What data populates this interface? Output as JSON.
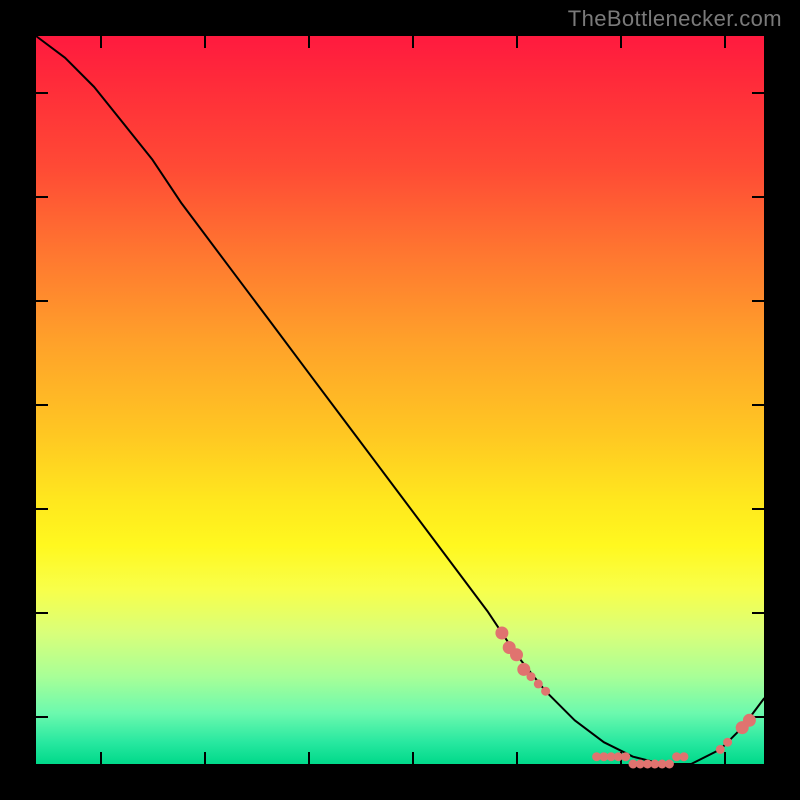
{
  "watermark": "TheBottlenecker.com",
  "chart_data": {
    "type": "line",
    "title": "",
    "xlabel": "",
    "ylabel": "",
    "xlim": [
      0,
      100
    ],
    "ylim": [
      0,
      100
    ],
    "curve": {
      "x": [
        0,
        4,
        8,
        12,
        16,
        20,
        26,
        32,
        38,
        44,
        50,
        56,
        62,
        66,
        70,
        74,
        78,
        82,
        86,
        90,
        94,
        97,
        100
      ],
      "y": [
        100,
        97,
        93,
        88,
        83,
        77,
        69,
        61,
        53,
        45,
        37,
        29,
        21,
        15,
        10,
        6,
        3,
        1,
        0,
        0,
        2,
        5,
        9
      ]
    },
    "dots": [
      {
        "x": 64,
        "y": 18,
        "size": "big"
      },
      {
        "x": 65,
        "y": 16,
        "size": "big"
      },
      {
        "x": 66,
        "y": 15,
        "size": "big"
      },
      {
        "x": 67,
        "y": 13,
        "size": "big"
      },
      {
        "x": 68,
        "y": 12,
        "size": "small"
      },
      {
        "x": 69,
        "y": 11,
        "size": "small"
      },
      {
        "x": 70,
        "y": 10,
        "size": "small"
      },
      {
        "x": 77,
        "y": 1,
        "size": "small"
      },
      {
        "x": 78,
        "y": 1,
        "size": "small"
      },
      {
        "x": 79,
        "y": 1,
        "size": "small"
      },
      {
        "x": 80,
        "y": 1,
        "size": "small"
      },
      {
        "x": 81,
        "y": 1,
        "size": "small"
      },
      {
        "x": 82,
        "y": 0,
        "size": "small"
      },
      {
        "x": 83,
        "y": 0,
        "size": "small"
      },
      {
        "x": 84,
        "y": 0,
        "size": "small"
      },
      {
        "x": 85,
        "y": 0,
        "size": "small"
      },
      {
        "x": 86,
        "y": 0,
        "size": "small"
      },
      {
        "x": 87,
        "y": 0,
        "size": "small"
      },
      {
        "x": 88,
        "y": 1,
        "size": "small"
      },
      {
        "x": 89,
        "y": 1,
        "size": "small"
      },
      {
        "x": 94,
        "y": 2,
        "size": "small"
      },
      {
        "x": 95,
        "y": 3,
        "size": "small"
      },
      {
        "x": 97,
        "y": 5,
        "size": "big"
      },
      {
        "x": 98,
        "y": 6,
        "size": "big"
      }
    ],
    "dot_color": "#e0736f",
    "curve_color": "#000000"
  }
}
